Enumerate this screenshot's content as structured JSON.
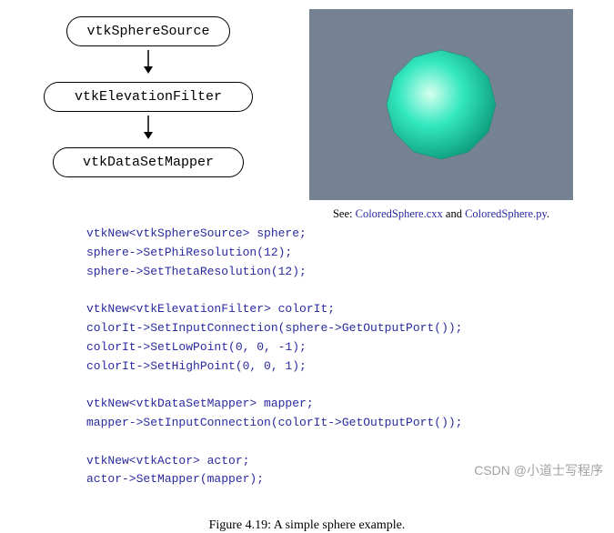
{
  "diagram": {
    "box1": "vtkSphereSource",
    "box2": "vtkElevationFilter",
    "box3": "vtkDataSetMapper"
  },
  "see": {
    "prefix": "See: ",
    "link1": "ColoredSphere.cxx",
    "and": " and ",
    "link2": "ColoredSphere.py",
    "suffix": "."
  },
  "code": {
    "l1": "vtkNew<vtkSphereSource> sphere;",
    "l2": "sphere->SetPhiResolution(12);",
    "l3": "sphere->SetThetaResolution(12);",
    "l4": "",
    "l5": "vtkNew<vtkElevationFilter> colorIt;",
    "l6": "colorIt->SetInputConnection(sphere->GetOutputPort());",
    "l7": "colorIt->SetLowPoint(0, 0, -1);",
    "l8": "colorIt->SetHighPoint(0, 0, 1);",
    "l9": "",
    "l10": "vtkNew<vtkDataSetMapper> mapper;",
    "l11": "mapper->SetInputConnection(colorIt->GetOutputPort());",
    "l12": "",
    "l13": "vtkNew<vtkActor> actor;",
    "l14": "actor->SetMapper(mapper);"
  },
  "caption": "Figure 4.19: A simple sphere example.",
  "watermark": "CSDN @小道士写程序"
}
